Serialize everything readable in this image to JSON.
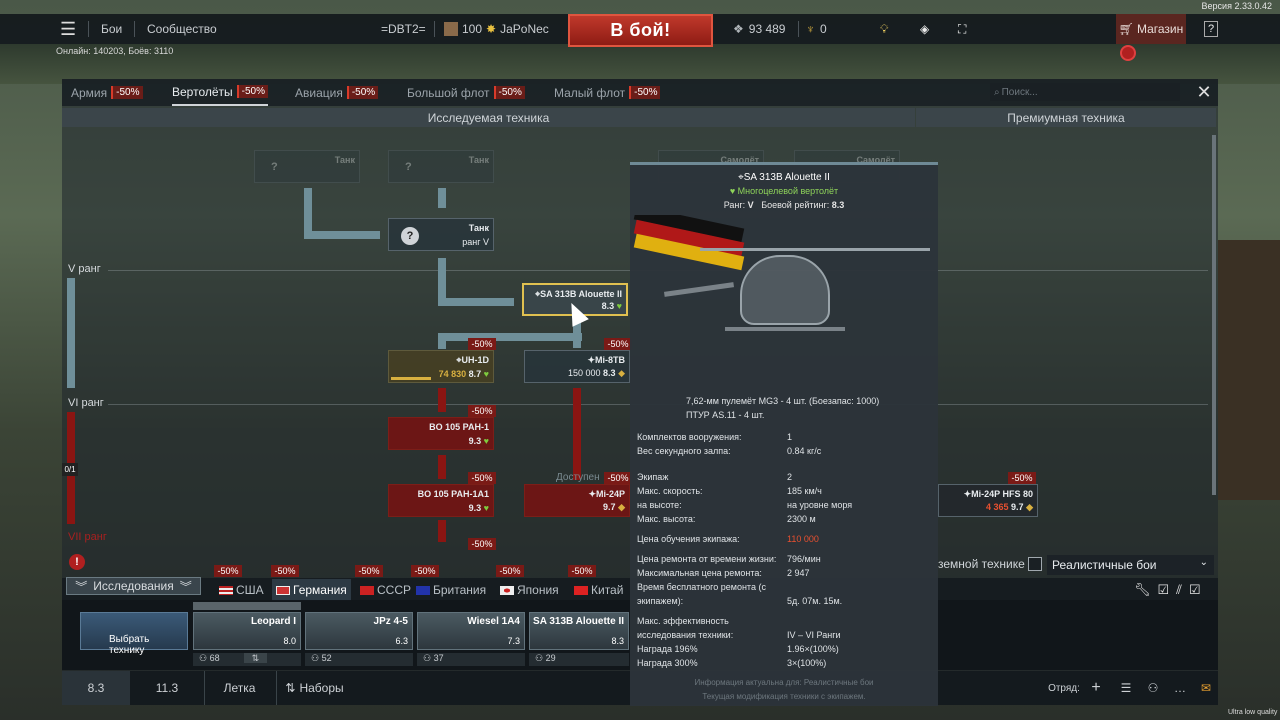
{
  "version": "Версия 2.33.0.42",
  "online": "Онлайн: 140203, Боёв: 3110",
  "topbar": {
    "battles": "Бои",
    "community": "Сообщество",
    "squad": "=DBT2=",
    "level": "100",
    "nickname": "JaPoNec",
    "play": "В бой!",
    "silver": "93 489",
    "gold": "0",
    "shop": "Магазин"
  },
  "tabs": [
    {
      "label": "Армия",
      "discount": "-50%"
    },
    {
      "label": "Вертолёты",
      "discount": "-50%"
    },
    {
      "label": "Авиация",
      "discount": "-50%"
    },
    {
      "label": "Большой флот",
      "discount": "-50%"
    },
    {
      "label": "Малый флот",
      "discount": "-50%"
    }
  ],
  "search_placeholder": "Поиск...",
  "headers": {
    "researched": "Исследуемая техника",
    "premium": "Премиумная техника"
  },
  "ranks": {
    "v": "V ранг",
    "vi": "VI ранг",
    "vii": "VII ранг",
    "progress": "0/1"
  },
  "tree": {
    "tank1": "Танк",
    "tank2": "Танк",
    "tank3": "Танк",
    "tank3_rank": "ранг V",
    "unknown": "?",
    "samolet": "Самолёт",
    "alouette": {
      "name": "SA 313B Alouette II",
      "br": "8.3"
    },
    "uh1d": {
      "name": "UH-1D",
      "progress": "74 830",
      "br": "8.7"
    },
    "mi8tb": {
      "name": "Mi-8TB",
      "cost": "150 000",
      "br": "8.3"
    },
    "bo105": {
      "name": "BO 105 PAH-1",
      "br": "9.3"
    },
    "bo105a1": {
      "name": "BO 105 PAH-1A1",
      "br": "9.3"
    },
    "mi24p": {
      "name": "Mi-24P",
      "br": "9.7"
    },
    "mi24phfs": {
      "name": "Mi-24P HFS 80",
      "cost": "4 365",
      "br": "9.7"
    },
    "discount": "-50%",
    "available": "Доступен"
  },
  "tooltip": {
    "name": "SA 313B Alouette II",
    "role": "Многоцелевой вертолёт",
    "rank_label": "Ранг:",
    "rank": "V",
    "br_label": "Боевой рейтинг:",
    "br": "8.3",
    "weapons1": "7,62-мм пулемёт MG3 - 4 шт. (Боезапас: 1000)",
    "weapons2": "ПТУР AS.11 - 4 шт.",
    "rows": [
      {
        "k": "Комплектов вооружения:",
        "v": "1"
      },
      {
        "k": "Вес секундного залпа:",
        "v": "0.84 кг/с"
      },
      {
        "k": "Экипаж",
        "v": "2"
      },
      {
        "k": "Макс. скорость:",
        "v": "185 км/ч"
      },
      {
        "k": "на высоте:",
        "v": "на уровне моря"
      },
      {
        "k": "Макс. высота:",
        "v": "2300 м"
      },
      {
        "k": "Цена обучения экипажа:",
        "v": "110 000"
      },
      {
        "k": "Цена ремонта от времени жизни:",
        "v": "796/мин"
      },
      {
        "k": "Максимальная цена ремонта:",
        "v": "2 947"
      },
      {
        "k": "Время бесплатного ремонта (с",
        "v": ""
      },
      {
        "k": "экипажем):",
        "v": "5д. 07м. 15м."
      },
      {
        "k": "Макс. эффективность",
        "v": ""
      },
      {
        "k": "исследования техники:",
        "v": "IV – VI Ранги"
      },
      {
        "k": "Награда 196%",
        "v": "1.96×(100%)"
      },
      {
        "k": "Награда 300%",
        "v": "3×(100%)"
      }
    ],
    "footer1": "Информация актуальна для: Реалистичные бои",
    "footer2": "Текущая модификация техники с экипажем."
  },
  "research_btn": "Исследования",
  "nations": [
    {
      "label": "США",
      "discount": "-50%"
    },
    {
      "label": "Германия",
      "discount": "-50%"
    },
    {
      "label": "СССР",
      "discount": "-50%"
    },
    {
      "label": "Британия",
      "discount": "-50%"
    },
    {
      "label": "Япония",
      "discount": "-50%"
    },
    {
      "label": "Китай",
      "discount": "-50%"
    }
  ],
  "ground_label": "земной технике",
  "game_mode": "Реалистичные бои",
  "crew": {
    "select": "Выбрать технику",
    "slots": [
      {
        "name": "Leopard I",
        "br": "8.0",
        "num": "68"
      },
      {
        "name": "JPz 4-5",
        "br": "6.3",
        "num": "52"
      },
      {
        "name": "Wiesel 1A4",
        "br": "7.3",
        "num": "37"
      },
      {
        "name": "SA 313B Alouette II",
        "br": "8.3",
        "num": "29"
      }
    ]
  },
  "bottom": {
    "br1": "8.3",
    "br2": "11.3",
    "airfield": "Летка",
    "presets": "Наборы",
    "squad": "Отряд:"
  },
  "low_quality": "Ultra low quality"
}
